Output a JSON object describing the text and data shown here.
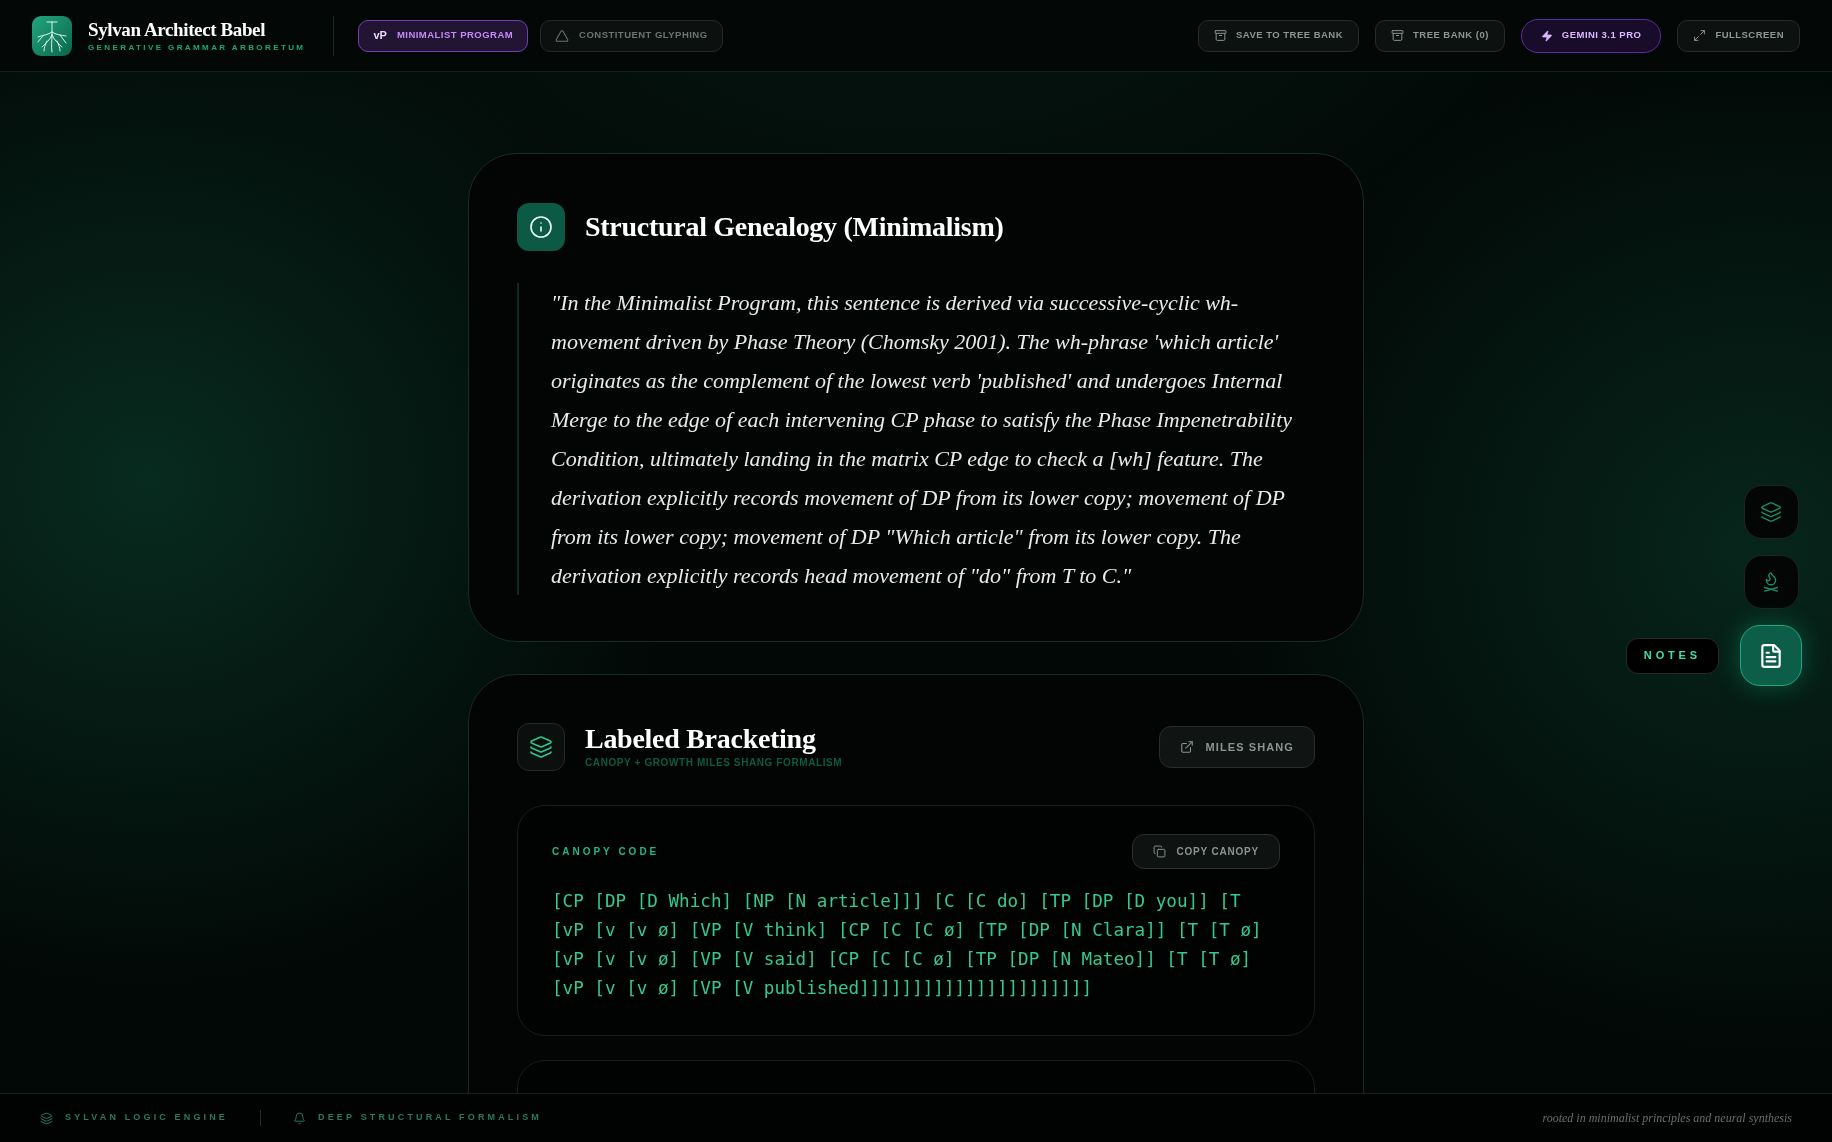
{
  "header": {
    "title": "Sylvan Architect Babel",
    "subtitle": "GENERATIVE GRAMMAR ARBORETUM",
    "modes": [
      {
        "kind": "badge",
        "badge": "vP",
        "label": "MINIMALIST PROGRAM",
        "selected": true
      },
      {
        "kind": "triangle",
        "label": "CONSTITUENT GLYPHING",
        "selected": false
      }
    ],
    "actions": [
      {
        "kind": "archive",
        "label": "SAVE TO TREE BANK"
      },
      {
        "kind": "archive",
        "label": "TREE BANK (0)"
      },
      {
        "kind": "model",
        "label": "GEMINI 3.1 PRO"
      },
      {
        "kind": "fullscreen",
        "label": "FULLSCREEN"
      }
    ]
  },
  "genealogy": {
    "title": "Structural Genealogy (Minimalism)",
    "quote": "\"In the Minimalist Program, this sentence is derived via successive-cyclic wh-movement driven by Phase Theory (Chomsky 2001). The wh-phrase 'which article' originates as the complement of the lowest verb 'published' and undergoes Internal Merge to the edge of each intervening CP phase to satisfy the Phase Impenetrability Condition, ultimately landing in the matrix CP edge to check a [wh] feature. The derivation explicitly records movement of DP from its lower copy; movement of DP from its lower copy; movement of DP \"Which article\" from its lower copy. The derivation explicitly records head movement of \"do\" from T to C.\""
  },
  "bracketing": {
    "title": "Labeled Bracketing",
    "subtitle": "CANOPY + GROWTH MILES SHANG FORMALISM",
    "link_button": "MILES SHANG",
    "code_label": "CANOPY CODE",
    "copy_button": "COPY CANOPY",
    "code": "[CP [DP [D Which] [NP [N article]]] [C [C do] [TP [DP [D you]] [T [vP [v [v ø] [VP [V think] [CP [C [C ø] [TP [DP [N Clara]] [T [T ø] [vP [v [v ø] [VP [V said] [CP [C [C ø] [TP [DP [N Mateo]] [T [T ø] [vP [v [v ø] [VP [V published]]]]]]]]]]]]]]]]]]]]]]"
  },
  "dock": [
    {
      "kind": "layers",
      "selected": false
    },
    {
      "kind": "campfire",
      "selected": false
    },
    {
      "kind": "notes",
      "selected": true,
      "tooltip": "NOTES"
    }
  ],
  "footer": {
    "items": [
      {
        "kind": "layers",
        "label": "SYLVAN LOGIC ENGINE"
      },
      {
        "kind": "bell",
        "label": "DEEP STRUCTURAL FORMALISM"
      }
    ],
    "tagline": "rooted in minimalist principles and neural synthesis"
  }
}
